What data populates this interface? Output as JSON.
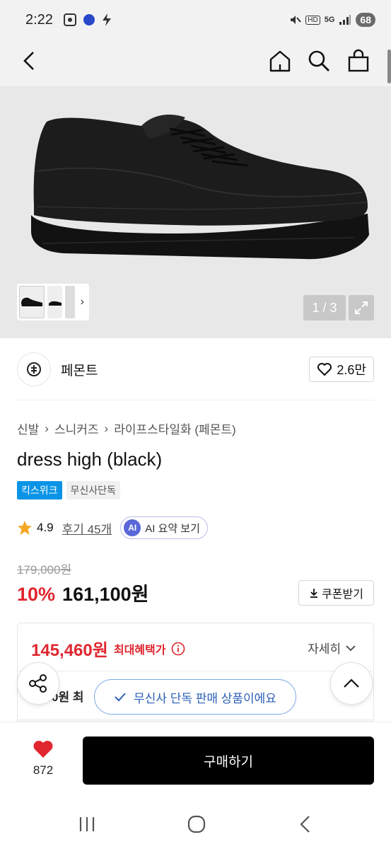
{
  "status_bar": {
    "time": "2:22",
    "battery": "68",
    "signal_labels": [
      "HD",
      "5G"
    ]
  },
  "top_nav": {
    "back_icon": "chevron-left-icon",
    "home_icon": "home-icon",
    "search_icon": "search-icon",
    "cart_icon": "shopping-bag-icon"
  },
  "gallery": {
    "counter": "1 / 3",
    "expand_icon": "expand-icon"
  },
  "brand": {
    "name": "페몬트",
    "likes": "2.6만"
  },
  "breadcrumb": [
    "신발",
    "스니커즈",
    "라이프스타일화 (페몬트)"
  ],
  "product": {
    "title": "dress high (black)",
    "badges": [
      "킥스위크",
      "무신사단독"
    ],
    "rating": "4.9",
    "reviews": "후기 45개",
    "ai_summary": "AI 요약 보기",
    "ai_badge": "AI",
    "original_price": "179,000원",
    "discount": "10%",
    "price": "161,100원",
    "coupon_label": "쿠폰받기"
  },
  "benefit": {
    "max_price": "145,460원",
    "max_label": "최대혜택가",
    "detail_label": "자세히",
    "sub_line": "0원 최"
  },
  "toast": {
    "text": "무신사 단독 판매 상품이에요"
  },
  "bottom_bar": {
    "wish_count": "872",
    "buy_label": "구매하기"
  },
  "colors": {
    "accent_red": "#e0262f",
    "badge_blue": "#0a94e6",
    "toast_blue": "#2c5fb8"
  }
}
